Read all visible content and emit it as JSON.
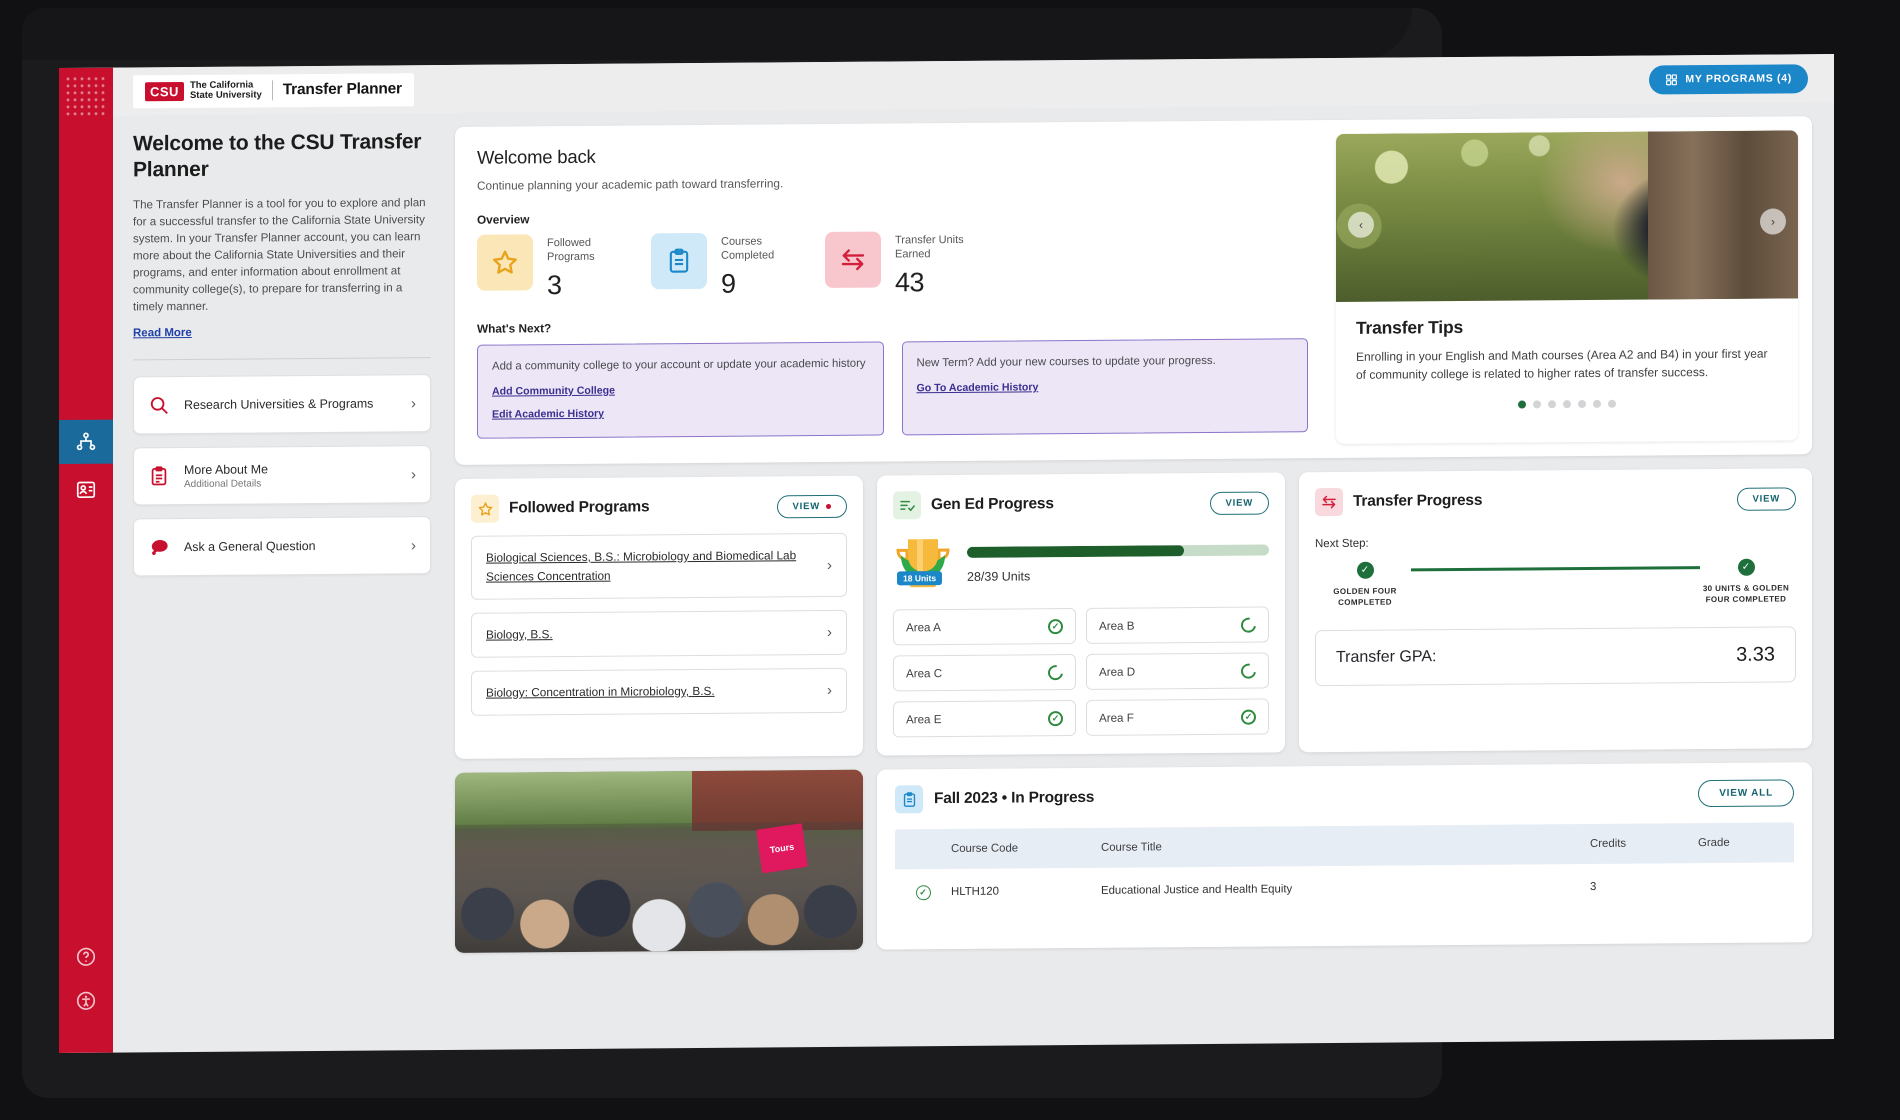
{
  "topbar": {
    "brand_mark": "CSU",
    "brand_line1": "The California",
    "brand_line2": "State University",
    "app_name": "Transfer Planner",
    "my_programs": "MY PROGRAMS (4)"
  },
  "sidebar": {
    "title": "Welcome to the CSU Transfer Planner",
    "body": "The Transfer Planner is a tool for you to explore and plan for a successful transfer to the California State University system. In your Transfer Planner account, you can learn more about the California State Universities and their programs, and enter information about enrollment at community college(s), to prepare for transferring in a timely manner.",
    "read_more": "Read More",
    "items": [
      {
        "label": "Research Universities & Programs",
        "sub": "",
        "icon": "search-icon"
      },
      {
        "label": "More About Me",
        "sub": "Additional Details",
        "icon": "clipboard-icon"
      },
      {
        "label": "Ask a General Question",
        "sub": "",
        "icon": "chat-icon"
      }
    ]
  },
  "welcome_back": {
    "title": "Welcome back",
    "subtitle": "Continue planning your academic path toward transferring.",
    "overview_label": "Overview",
    "stats": [
      {
        "label": "Followed Programs",
        "value": "3",
        "icon": "star-icon",
        "bg": "#fbe6b8",
        "fg": "#e8a21c"
      },
      {
        "label": "Courses Completed",
        "value": "9",
        "icon": "clipboard-icon",
        "bg": "#cfe9f8",
        "fg": "#1b87c9"
      },
      {
        "label": "Transfer Units Earned",
        "value": "43",
        "icon": "transfer-icon",
        "bg": "#f8c7ce",
        "fg": "#d21f3c"
      }
    ],
    "whats_next_label": "What's Next?",
    "whats_next": [
      {
        "text": "Add a community college to your account or update your academic history",
        "links": [
          "Add Community College",
          "Edit Academic History"
        ]
      },
      {
        "text": "New Term? Add your new courses to update your progress.",
        "links": [
          "Go To Academic History"
        ]
      }
    ]
  },
  "tips": {
    "title": "Transfer Tips",
    "text": "Enrolling in your English and Math courses (Area A2 and B4) in your first year of community college is related to higher rates of transfer success.",
    "dots": 7,
    "active_dot": 0
  },
  "followed_programs": {
    "title": "Followed Programs",
    "view_label": "VIEW",
    "items": [
      "Biological Sciences, B.S.: Microbiology and Biomedical Lab Sciences Concentration",
      "Biology, B.S.",
      "Biology: Concentration in Microbiology, B.S."
    ]
  },
  "gen_ed": {
    "title": "Gen Ed Progress",
    "view_label": "VIEW",
    "badge_units": "18 Units",
    "units_text": "28/39 Units",
    "completed_units": 28,
    "total_units": 39,
    "percent": 72,
    "areas": [
      {
        "label": "Area A",
        "status": "complete"
      },
      {
        "label": "Area B",
        "status": "in-progress"
      },
      {
        "label": "Area C",
        "status": "in-progress"
      },
      {
        "label": "Area D",
        "status": "in-progress"
      },
      {
        "label": "Area E",
        "status": "complete"
      },
      {
        "label": "Area F",
        "status": "complete"
      }
    ]
  },
  "transfer_progress": {
    "title": "Transfer Progress",
    "view_label": "VIEW",
    "next_step_label": "Next Step:",
    "steps": [
      {
        "label": "GOLDEN FOUR COMPLETED",
        "status": "complete"
      },
      {
        "label": "30 UNITS & GOLDEN FOUR COMPLETED",
        "status": "complete"
      }
    ],
    "gpa_label": "Transfer GPA:",
    "gpa_value": "3.33"
  },
  "term": {
    "title": "Fall 2023 • In Progress",
    "view_all": "VIEW ALL",
    "columns": [
      "",
      "Course Code",
      "Course Title",
      "Credits",
      "Grade"
    ],
    "rows": [
      {
        "status": "complete",
        "code": "HLTH120",
        "title": "Educational Justice and Health Equity",
        "credits": "3",
        "grade": ""
      }
    ]
  },
  "photo_card": {
    "sign_text": "Tours"
  },
  "colors": {
    "brand_red": "#c8102e",
    "accent_blue": "#1b87c9",
    "green": "#1f6f3d",
    "purple": "#3b2f8f"
  }
}
